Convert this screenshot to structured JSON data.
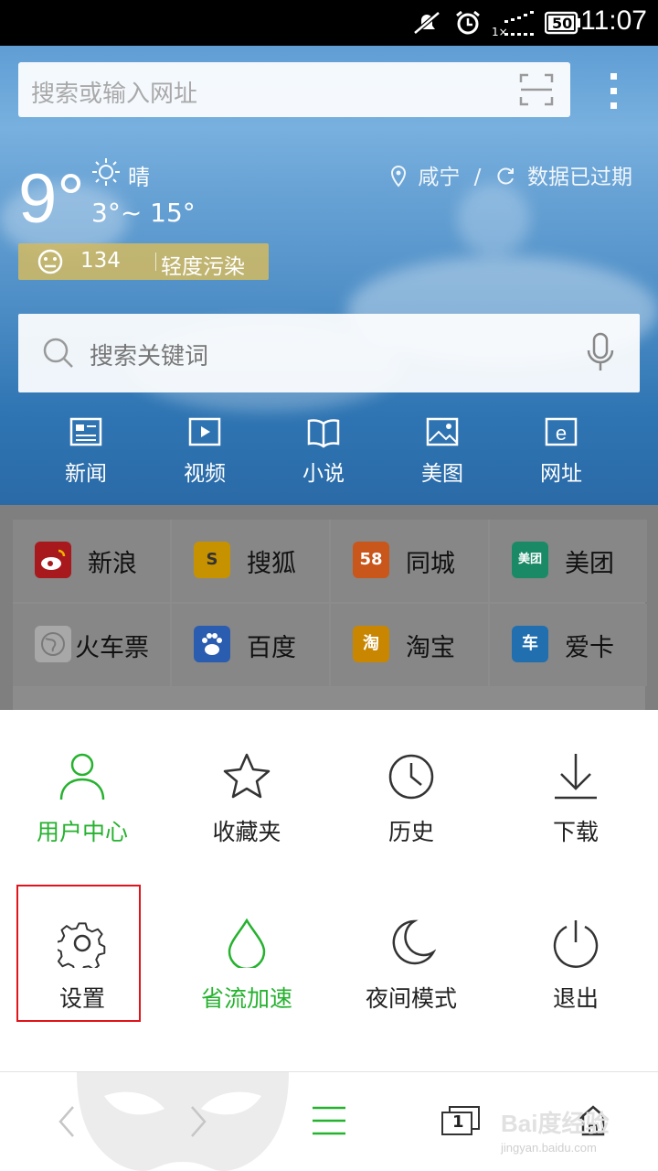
{
  "status_bar": {
    "time": "11:07",
    "battery": "50",
    "network_rate": "1×"
  },
  "address_bar": {
    "placeholder": "搜索或输入网址"
  },
  "weather": {
    "temperature": "9°",
    "condition": "晴",
    "range": "3°~ 15°",
    "city": "咸宁",
    "separator": "/",
    "status": "数据已过期",
    "aqi_value": "134",
    "aqi_level": "轻度污染"
  },
  "keyword_search": {
    "placeholder": "搜索关键词"
  },
  "categories": [
    {
      "label": "新闻",
      "icon": "news-icon"
    },
    {
      "label": "视频",
      "icon": "video-icon"
    },
    {
      "label": "小说",
      "icon": "book-icon"
    },
    {
      "label": "美图",
      "icon": "picture-icon"
    },
    {
      "label": "网址",
      "icon": "web-icon"
    }
  ],
  "quick_links": [
    {
      "label": "新浪",
      "badge": "",
      "color": "#c8161d"
    },
    {
      "label": "搜狐",
      "badge": "S",
      "color": "#f0b400"
    },
    {
      "label": "同城",
      "badge": "58",
      "color": "#f06e1a"
    },
    {
      "label": "美团",
      "badge": "美团",
      "color": "#1aa37a"
    },
    {
      "label": "火车票",
      "badge": "",
      "color": "#cfcfcf"
    },
    {
      "label": "百度",
      "badge": "",
      "color": "#2f6fd6"
    },
    {
      "label": "淘宝",
      "badge": "淘",
      "color": "#f0a000"
    },
    {
      "label": "爱卡",
      "badge": "车",
      "color": "#2b86d6"
    }
  ],
  "menu": [
    {
      "label": "用户中心",
      "icon": "user-icon",
      "active": true
    },
    {
      "label": "收藏夹",
      "icon": "star-icon",
      "active": false
    },
    {
      "label": "历史",
      "icon": "clock-icon",
      "active": false
    },
    {
      "label": "下载",
      "icon": "download-icon",
      "active": false
    },
    {
      "label": "设置",
      "icon": "gear-icon",
      "active": false
    },
    {
      "label": "省流加速",
      "icon": "droplet-icon",
      "active": true
    },
    {
      "label": "夜间模式",
      "icon": "moon-icon",
      "active": false
    },
    {
      "label": "退出",
      "icon": "power-icon",
      "active": false
    }
  ],
  "bottom_bar": {
    "tab_count": "1"
  },
  "watermark": {
    "brand": "Bai度经验",
    "url": "jingyan.baidu.com"
  },
  "colors": {
    "accent_green": "#25b22e",
    "highlight_red": "#e0141a"
  }
}
